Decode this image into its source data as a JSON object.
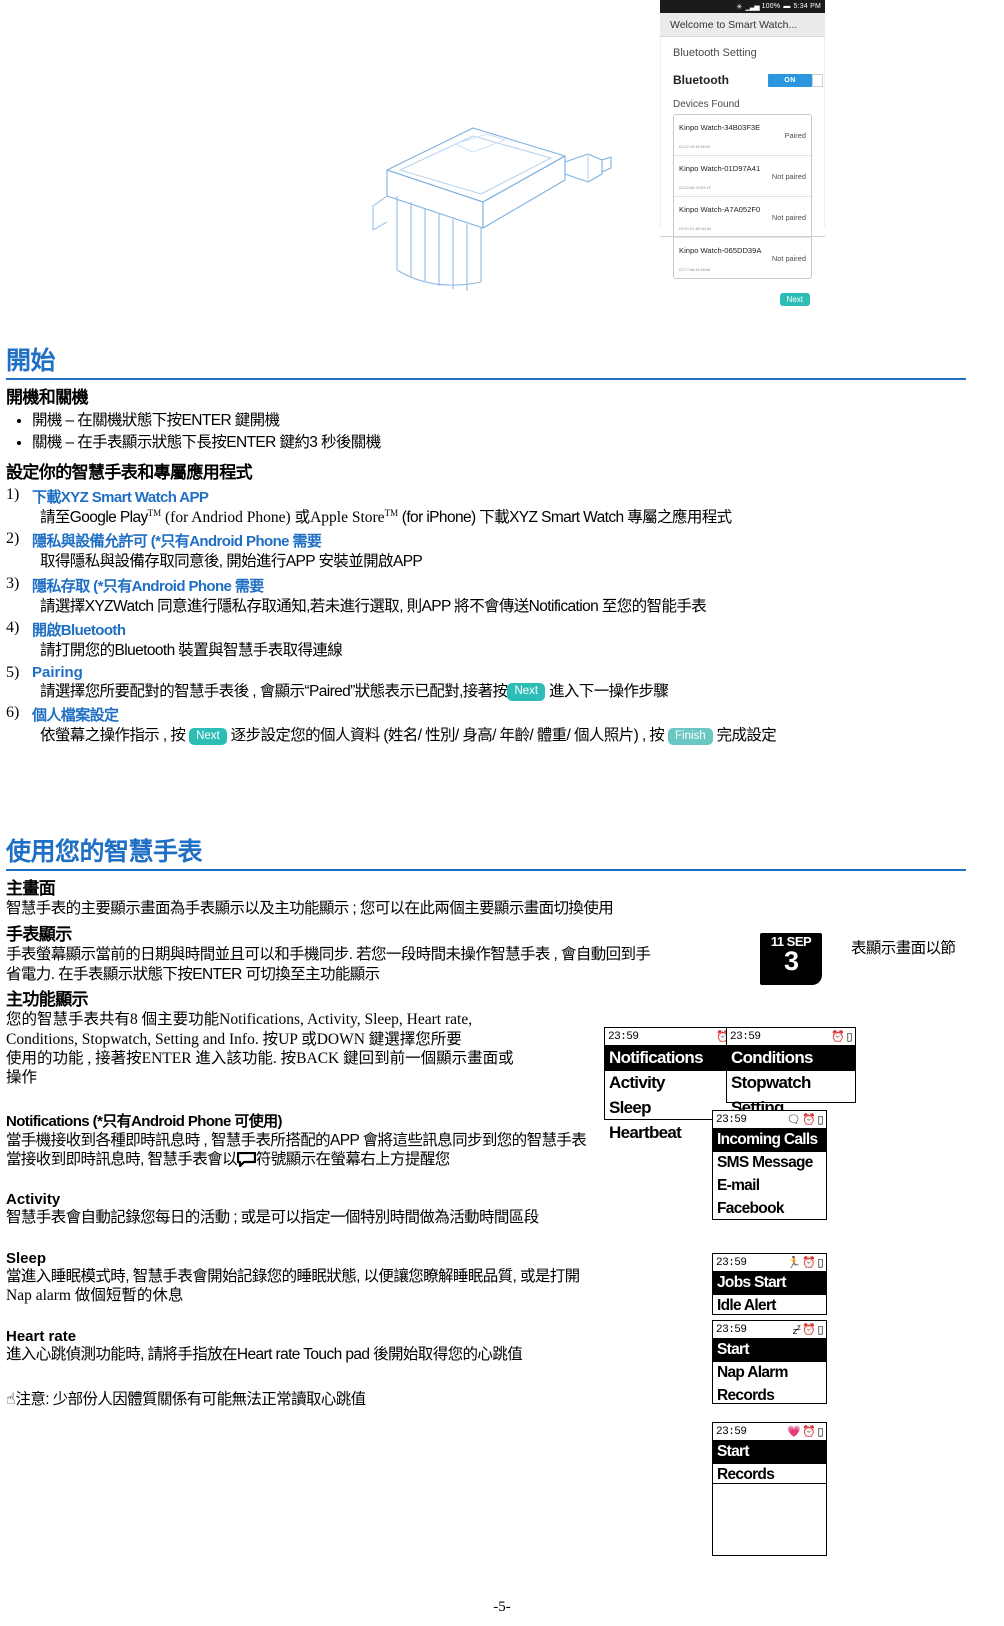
{
  "phone_screenshot": {
    "status_bar": {
      "battery": "100%",
      "time": "5:34 PM",
      "icons": "bluetooth signal battery"
    },
    "app_title": "Welcome to Smart Watch...",
    "screen_heading": "Bluetooth Setting",
    "bluetooth_label": "Bluetooth",
    "bluetooth_toggle": "ON",
    "devices_heading": "Devices Found",
    "devices": [
      {
        "name": "Kinpo Watch-34B03F3E",
        "mac": "D2:22:33:44:55:00",
        "state": "Paired"
      },
      {
        "name": "Kinpo Watch-01D97A41",
        "mac": "D2:22:85:29:E9:1F",
        "state": "Not paired"
      },
      {
        "name": "Kinpo Watch-A7A052F0",
        "mac": "D2:01:E1:6D:84:84",
        "state": "Not paired"
      },
      {
        "name": "Kinpo Watch-065DD39A",
        "mac": "D2:77:88:44:55:68",
        "state": "Not paired"
      }
    ],
    "next_button": "Next"
  },
  "section_start": {
    "title": "開始",
    "power_heading": "開機和關機",
    "bullets": [
      "開機 – 在關機狀態下按ENTER 鍵開機",
      "關機 – 在手表顯示狀態下長按ENTER 鍵約3 秒後關機"
    ],
    "setup_heading": "設定你的智慧手表和專屬應用程式",
    "steps": [
      {
        "n": "1)",
        "title": "下載XYZ Smart Watch APP",
        "desc_a": "請至Google Play",
        "tm1": "TM",
        "desc_b": " (for Andriod Phone) 或Apple Store",
        "tm2": "TM",
        "desc_c": " (for iPhone) 下載XYZ Smart Watch 專屬之應用程式"
      },
      {
        "n": "2)",
        "title": "隱私與設備允許可 (*只有Android Phone 需要",
        "desc": "取得隱私與設備存取同意後, 開始進行APP 安裝並開啟APP"
      },
      {
        "n": "3)",
        "title": "隱私存取 (*只有Android Phone 需要",
        "desc": "請選擇XYZWatch 同意進行隱私存取通知,若未進行選取, 則APP 將不會傳送Notification 至您的智能手表"
      },
      {
        "n": "4)",
        "title": "開啟Bluetooth",
        "desc": "請打開您的Bluetooth 裝置與智慧手表取得連線"
      },
      {
        "n": "5)",
        "title": "Pairing",
        "desc_pre": "請選擇您所要配對的智慧手表後 , 會顯示“Paired”狀態表示已配對,接著按",
        "chip": "Next",
        "desc_post": "進入下一操作步驟"
      },
      {
        "n": "6)",
        "title": "個人檔案設定",
        "desc_pre": "依螢幕之操作指示 , 按",
        "chip1": "Next",
        "desc_mid": "逐步設定您的個人資料 (姓名/ 性別/ 身高/ 年齡/ 體重/ 個人照片) , 按",
        "chip2": "Finish",
        "desc_post": "完成設定"
      }
    ]
  },
  "section_use": {
    "title": "使用您的智慧手表",
    "main_screen_heading": "主畫面",
    "main_screen_text": "智慧手表的主要顯示畫面為手表顯示以及主功能顯示 ; 您可以在此兩個主要顯示畫面切換使用",
    "watch_display_heading": "手表顯示",
    "watch_display_text_a": "手表螢幕顯示當前的日期與時間並且可以和手機同步. 若您一段時間未操作智慧手表 , 會自動回到手",
    "watch_display_text_b": "表顯示畫面以節",
    "watch_display_text_c": "省電力. 在手表顯示狀態下按ENTER 可切換至主功能顯示",
    "date_badge": {
      "month": "11 SEP",
      "day": "3"
    },
    "main_func_heading": "主功能顯示",
    "main_func_text": [
      "您的智慧手表共有8 個主要功能Notifications, Activity, Sleep, Heart rate,",
      "Conditions, Stopwatch, Setting and Info. 按UP 或DOWN 鍵選擇您所要",
      "使用的功能 , 接著按ENTER 進入該功能. 按BACK 鍵回到前一個顯示畫面或",
      "操作"
    ],
    "notifications_heading": "Notifications (*只有Android Phone 可使用)",
    "notifications_text_a": "當手機接收到各種即時訊息時 , 智慧手表所搭配的APP 會將這些訊息同步到您的智慧手表",
    "notifications_text_b_pre": "當接收到即時訊息時, 智慧手表會以",
    "notifications_text_b_post": "符號顯示在螢幕右上方提醒您",
    "activity_heading": "Activity",
    "activity_text": "智慧手表會自動記錄您每日的活動 ; 或是可以指定一個特別時間做為活動時間區段",
    "sleep_heading": "Sleep",
    "sleep_text_a": "當進入睡眠模式時, 智慧手表會開始記錄您的睡眠狀態, 以便讓您瞭解睡眠品質, 或是打開",
    "sleep_text_b": "Nap alarm 做個短暫的休息",
    "heart_heading": "Heart rate",
    "heart_text": "進入心跳偵測功能時, 請將手指放在Heart rate Touch pad 後開始取得您的心跳值",
    "note_text": "注意: 少部份人因體質關係有可能無法正常讀取心跳值"
  },
  "watch_screens": [
    {
      "id": "main-menu-1",
      "time": "23:59",
      "icons": [
        "alarm",
        "battery"
      ],
      "rows": [
        {
          "label": "Notifications",
          "selected": true
        },
        {
          "label": "Activity",
          "selected": false
        },
        {
          "label": "Sleep",
          "selected": false
        },
        {
          "label": "Heartbeat",
          "selected": false
        }
      ]
    },
    {
      "id": "main-menu-2",
      "time": "23:59",
      "icons": [
        "alarm",
        "battery"
      ],
      "rows": [
        {
          "label": "Conditions",
          "selected": true
        },
        {
          "label": "Stopwatch",
          "selected": false
        },
        {
          "label": "Setting",
          "selected": false
        }
      ]
    },
    {
      "id": "notifications-menu",
      "time": "23:59",
      "icons": [
        "message",
        "alarm",
        "battery"
      ],
      "rows": [
        {
          "label": "Incoming Calls",
          "selected": true
        },
        {
          "label": "SMS Message",
          "selected": false
        },
        {
          "label": "E-mail",
          "selected": false
        },
        {
          "label": "Facebook",
          "selected": false
        }
      ]
    },
    {
      "id": "activity-menu",
      "time": "23:59",
      "icons": [
        "running",
        "alarm",
        "battery"
      ],
      "rows": [
        {
          "label": "Jobs Start",
          "selected": true
        },
        {
          "label": "Idle Alert",
          "selected": false
        }
      ]
    },
    {
      "id": "sleep-menu",
      "time": "23:59",
      "icons": [
        "sleep",
        "alarm",
        "battery"
      ],
      "rows": [
        {
          "label": "Start",
          "selected": true
        },
        {
          "label": "Nap Alarm",
          "selected": false
        },
        {
          "label": "Records",
          "selected": false
        }
      ]
    },
    {
      "id": "heartrate-menu",
      "time": "23:59",
      "icons": [
        "heart",
        "alarm",
        "battery"
      ],
      "rows": [
        {
          "label": "Start",
          "selected": true
        },
        {
          "label": "Records",
          "selected": false
        }
      ]
    }
  ],
  "footer": {
    "page_number": "-5-"
  },
  "colors": {
    "accent_blue": "#1f6fc4",
    "chip_teal": "#2ebdb6",
    "toggle_blue": "#2c97de"
  }
}
